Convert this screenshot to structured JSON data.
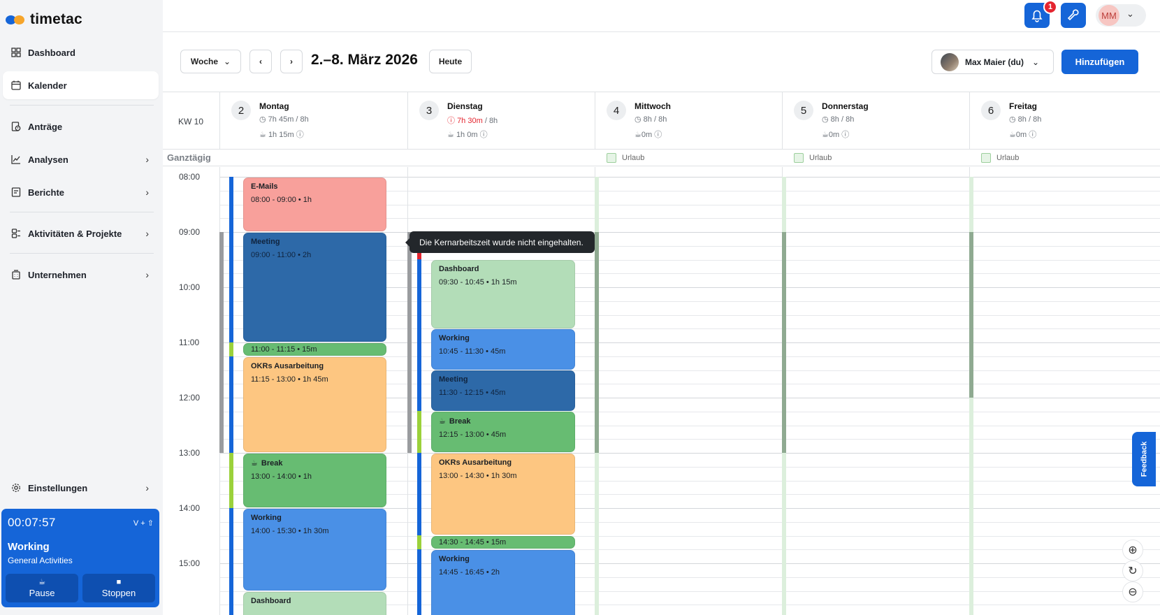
{
  "app": {
    "logo_text": "timetac"
  },
  "sidebar": {
    "items": [
      {
        "label": "Dashboard",
        "icon": "grid-icon"
      },
      {
        "label": "Kalender",
        "icon": "calendar-icon",
        "active": true
      },
      {
        "label": "Anträge",
        "icon": "request-icon"
      },
      {
        "label": "Analysen",
        "icon": "chart-icon"
      },
      {
        "label": "Berichte",
        "icon": "report-icon"
      },
      {
        "label": "Aktivitäten & Projekte",
        "icon": "activity-icon"
      },
      {
        "label": "Unternehmen",
        "icon": "building-icon"
      }
    ],
    "settings_label": "Einstellungen"
  },
  "timer": {
    "time": "00:07:57",
    "shortcut": "V + ⇧",
    "status": "Working",
    "activity": "General Activities",
    "pause_label": "Pause",
    "stop_label": "Stoppen"
  },
  "topbar": {
    "notification_count": "1",
    "user_initials": "MM"
  },
  "toolbar": {
    "view_label": "Woche",
    "date_range": "2.–8. März 2026",
    "today_label": "Heute",
    "person_label": "Max Maier (du)",
    "add_label": "Hinzufügen"
  },
  "calendar": {
    "week_label": "KW 10",
    "allday_label": "Ganztägig",
    "days": [
      {
        "num": "2",
        "name": "Montag",
        "hours_done": "7h 45m",
        "hours_target": "8h",
        "break": "1h 15m",
        "warn": false
      },
      {
        "num": "3",
        "name": "Dienstag",
        "hours_done": "7h 30m",
        "hours_target": "8h",
        "break": "1h 0m",
        "warn": true
      },
      {
        "num": "4",
        "name": "Mittwoch",
        "hours_done": "8h",
        "hours_target": "8h",
        "break": "0m",
        "warn": false,
        "allday": "Urlaub"
      },
      {
        "num": "5",
        "name": "Donnerstag",
        "hours_done": "8h",
        "hours_target": "8h",
        "break": "0m",
        "warn": false,
        "allday": "Urlaub"
      },
      {
        "num": "6",
        "name": "Freitag",
        "hours_done": "8h",
        "hours_target": "8h",
        "break": "0m",
        "warn": false,
        "allday": "Urlaub"
      }
    ],
    "time_labels": [
      "08:00",
      "09:00",
      "10:00",
      "11:00",
      "12:00",
      "13:00",
      "14:00",
      "15:00"
    ],
    "monday_events": [
      {
        "title": "E-Mails",
        "time": "08:00 - 09:00 • 1h",
        "color": "red"
      },
      {
        "title": "Meeting",
        "time": "09:00 - 11:00 • 2h",
        "color": "dblue"
      },
      {
        "title": "",
        "time": "11:00 - 11:15 • 15m",
        "color": "green"
      },
      {
        "title": "OKRs Ausarbeitung",
        "time": "11:15 - 13:00 • 1h 45m",
        "color": "orange"
      },
      {
        "title": "Break",
        "time": "13:00 - 14:00 • 1h",
        "color": "green",
        "icon": "coffee-icon"
      },
      {
        "title": "Working",
        "time": "14:00 - 15:30 • 1h 30m",
        "color": "lblue"
      },
      {
        "title": "Dashboard",
        "time": "",
        "color": "mint"
      }
    ],
    "tuesday_events": [
      {
        "title": "Dashboard",
        "time": "09:30 - 10:45 • 1h 15m",
        "color": "mint"
      },
      {
        "title": "Working",
        "time": "10:45 - 11:30 • 45m",
        "color": "lblue"
      },
      {
        "title": "Meeting",
        "time": "11:30 - 12:15 • 45m",
        "color": "dblue"
      },
      {
        "title": "Break",
        "time": "12:15 - 13:00 • 45m",
        "color": "green",
        "icon": "coffee-icon"
      },
      {
        "title": "OKRs Ausarbeitung",
        "time": "13:00 - 14:30 • 1h 30m",
        "color": "orange"
      },
      {
        "title": "",
        "time": "14:30 - 14:45 • 15m",
        "color": "green"
      },
      {
        "title": "Working",
        "time": "14:45 - 16:45 • 2h",
        "color": "lblue"
      }
    ],
    "tooltip": "Die Kernarbeitszeit wurde nicht eingehalten."
  },
  "feedback_label": "Feedback",
  "colors": {
    "primary": "#1565d8",
    "red_event": "#f8a09b",
    "dark_blue_event": "#2d69a8",
    "green_event": "#67bc72",
    "orange_event": "#fdc681",
    "light_blue_event": "#4a90e6",
    "mint_event": "#b3ddb8",
    "warning": "#e4252f"
  }
}
